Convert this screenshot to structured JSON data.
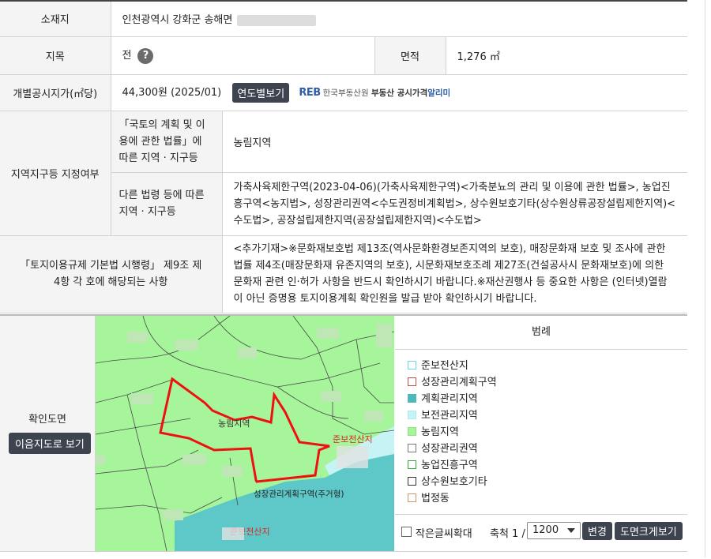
{
  "rows": {
    "location_label": "소재지",
    "location_value": "인천광역시 강화군 송해면",
    "jimok_label": "지목",
    "jimok_value": "전",
    "jimok_help": "?",
    "area_label": "면적",
    "area_value": "1,276 ㎡",
    "price_label": "개별공시지가(㎡당)",
    "price_value": "44,300원 (2025/01)",
    "year_button": "연도별보기",
    "reb_logo": "REB",
    "reb_name": "한국부동산원",
    "reb_service": "부동산 공시가격",
    "reb_alimi": "알리미",
    "zone_label": "지역지구등 지정여부",
    "zone_law1_label": "「국토의 계획 및 이용에 관한 법률」에 따른 지역 · 지구등",
    "zone_law1_value": "농림지역",
    "zone_law2_label": "다른 법령 등에 따른 지역 · 지구등",
    "zone_law2_value": "가축사육제한구역(2023-04-06)(가축사육제한구역)<가축분뇨의 관리 및 이용에 관한 법률>, 농업진흥구역<농지법>, 성장관리권역<수도권정비계획법>, 상수원보호기타(상수원상류공장설립제한지역)<수도법>, 공장설립제한지역(공장설립제한지역)<수도법>",
    "regulation_label": "「토지이용규제 기본법 시행령」 제9조 제4항 각 호에 해당되는 사항",
    "regulation_value": "<추가기재>※문화재보호법 제13조(역사문화환경보존지역의 보호), 매장문화재 보호 및 조사에 관한 법률 제4조(매장문화재 유존지역의 보호), 시문화재보호조례 제27조(건설공사시 문화재보호)에 의한 문화재 관련 인·허가 사항을 반드시 확인하시기 바랍니다.※재산권행사 등 중요한 사항은 (인터넷)열람이 아닌 증명용 토지이용계획 확인원을 발급 받아 확인하시기 바랍니다."
  },
  "map_section": {
    "label": "확인도면",
    "view_button": "이음지도로 보기",
    "map_labels": {
      "parcel": "농림지역",
      "zone_red": "준보전산지",
      "zone_blue": "성장관리계획구역(주거형)",
      "zone_red2": "준보전산지"
    }
  },
  "legend": {
    "title": "범례",
    "items": [
      {
        "label": "준보전산지",
        "color": "#6fd7e3",
        "fill": "#ffffff"
      },
      {
        "label": "성장관리계획구역",
        "color": "#c0504d",
        "fill": "#ffffff"
      },
      {
        "label": "계획관리지역",
        "color": "#4fb8b8",
        "fill": "#4fb8b8"
      },
      {
        "label": "보전관리지역",
        "color": "#a9eef2",
        "fill": "#c8f3f5"
      },
      {
        "label": "농림지역",
        "color": "#8fe47d",
        "fill": "#a6f59a"
      },
      {
        "label": "성장관리권역",
        "color": "#777777",
        "fill": "#ffffff"
      },
      {
        "label": "농업진흥구역",
        "color": "#3aa83a",
        "fill": "#ffffff"
      },
      {
        "label": "상수원보호기타",
        "color": "#333333",
        "fill": "#ffffff"
      },
      {
        "label": "법정동",
        "color": "#c79a73",
        "fill": "#ffffff"
      }
    ]
  },
  "controls": {
    "small_text_label": "작은글씨확대",
    "scale_label": "축척 1 /",
    "scale_value": "1200",
    "change_button": "변경",
    "large_view_button": "도면크게보기"
  }
}
